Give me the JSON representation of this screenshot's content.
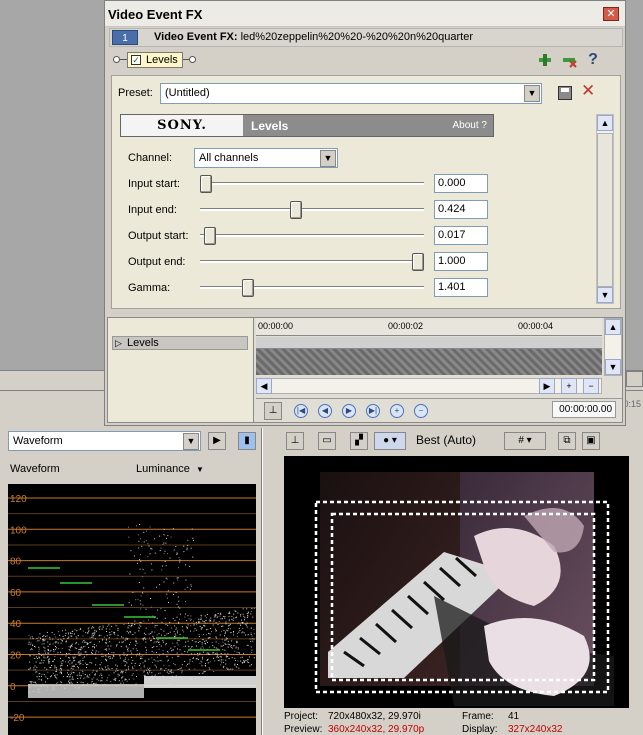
{
  "dialog": {
    "title": "Video Event FX",
    "close_glyph": "✕",
    "chain_index": "1",
    "chain_prefix": "Video Event FX:",
    "chain_name": "led%20zeppelin%20%20-%20%20n%20quarter",
    "plugin_name": "Levels",
    "plugin_checkbox": "✓",
    "toolbar_icons": [
      "insert-plugin-icon",
      "remove-plugin-icon",
      "help-icon"
    ],
    "help_glyph": "?",
    "preset": {
      "label": "Preset:",
      "value": "(Untitled)"
    },
    "header": {
      "brand": "SONY.",
      "plugin_title": "Levels",
      "about": "About  ?"
    },
    "params": {
      "channel_label": "Channel:",
      "channel_value": "All channels",
      "input_start": {
        "label": "Input start:",
        "value": "0.000",
        "level": 0.0
      },
      "input_end": {
        "label": "Input end:",
        "value": "0.424",
        "level": 0.424
      },
      "output_start": {
        "label": "Output start:",
        "value": "0.017",
        "level": 0.017
      },
      "output_end": {
        "label": "Output end:",
        "value": "1.000",
        "level": 1.0
      },
      "gamma": {
        "label": "Gamma:",
        "value": "1.401",
        "level": 0.2
      }
    },
    "timeline": {
      "track_label": "Levels",
      "ruler": [
        "00:00:00",
        "00:00:02",
        "00:00:04"
      ],
      "current_time": "00:00:00.00",
      "hscroll_plus": "+",
      "hscroll_minus": "−"
    }
  },
  "ruler_fragment": "0:15",
  "waveform": {
    "view_mode": "Waveform",
    "title": "Waveform",
    "mode": "Luminance",
    "mode_arrow": "▼",
    "scale": [
      "120",
      "100",
      "80",
      "60",
      "40",
      "20",
      "0",
      "-20"
    ],
    "grid_color": "#c97a2a"
  },
  "preview": {
    "quality": "Best (Auto)",
    "project_label": "Project:",
    "project_value": "720x480x32, 29.970i",
    "preview_label": "Preview:",
    "preview_value": "360x240x32, 29.970p",
    "frame_label": "Frame:",
    "frame_value": "41",
    "display_label": "Display:",
    "display_value": "327x240x32"
  }
}
